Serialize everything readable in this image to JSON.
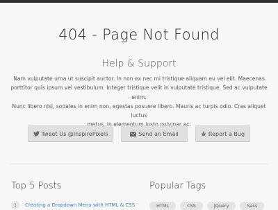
{
  "page": {
    "title": "404 - Page Not Found"
  },
  "support": {
    "title": "Help & Support",
    "lines": [
      "Nam vulputate urna ut suscipit auctor. In non ex nec mi tristique aliquam eu vel elit. Maecenas",
      "porttitor quis ipsum vel vestibulum. Integer tristique velit in vulputate tristique. Sed ac vulputate enim.",
      "Nunc libero nisl, sodales in enim non, egestas posuere libero. Mauris ac turpis odio. Cras aliquet luctus",
      "metus, in elementum justo pulvinar ac."
    ]
  },
  "buttons": {
    "tweet_label": "Tweet Us @InspirePixels",
    "tweet_icon": "twitter-icon",
    "email_label": "Send an Email",
    "email_icon": "envelope-icon",
    "bug_label": "Report a Bug",
    "bug_icon": "bug-icon"
  },
  "posts": {
    "title": "Top 5 Posts",
    "items": [
      {
        "num": "1",
        "label": "Creating a Dropdown Menu with HTML & CSS"
      }
    ]
  },
  "tags": {
    "title": "Popular Tags",
    "items": [
      "HTML",
      "CSS",
      "jQuery",
      "Sass"
    ]
  },
  "colors": {
    "topbar": "#2b2f33",
    "background": "#f7f7f7",
    "link": "#3b7fc4",
    "button": "#e0e0e0"
  }
}
